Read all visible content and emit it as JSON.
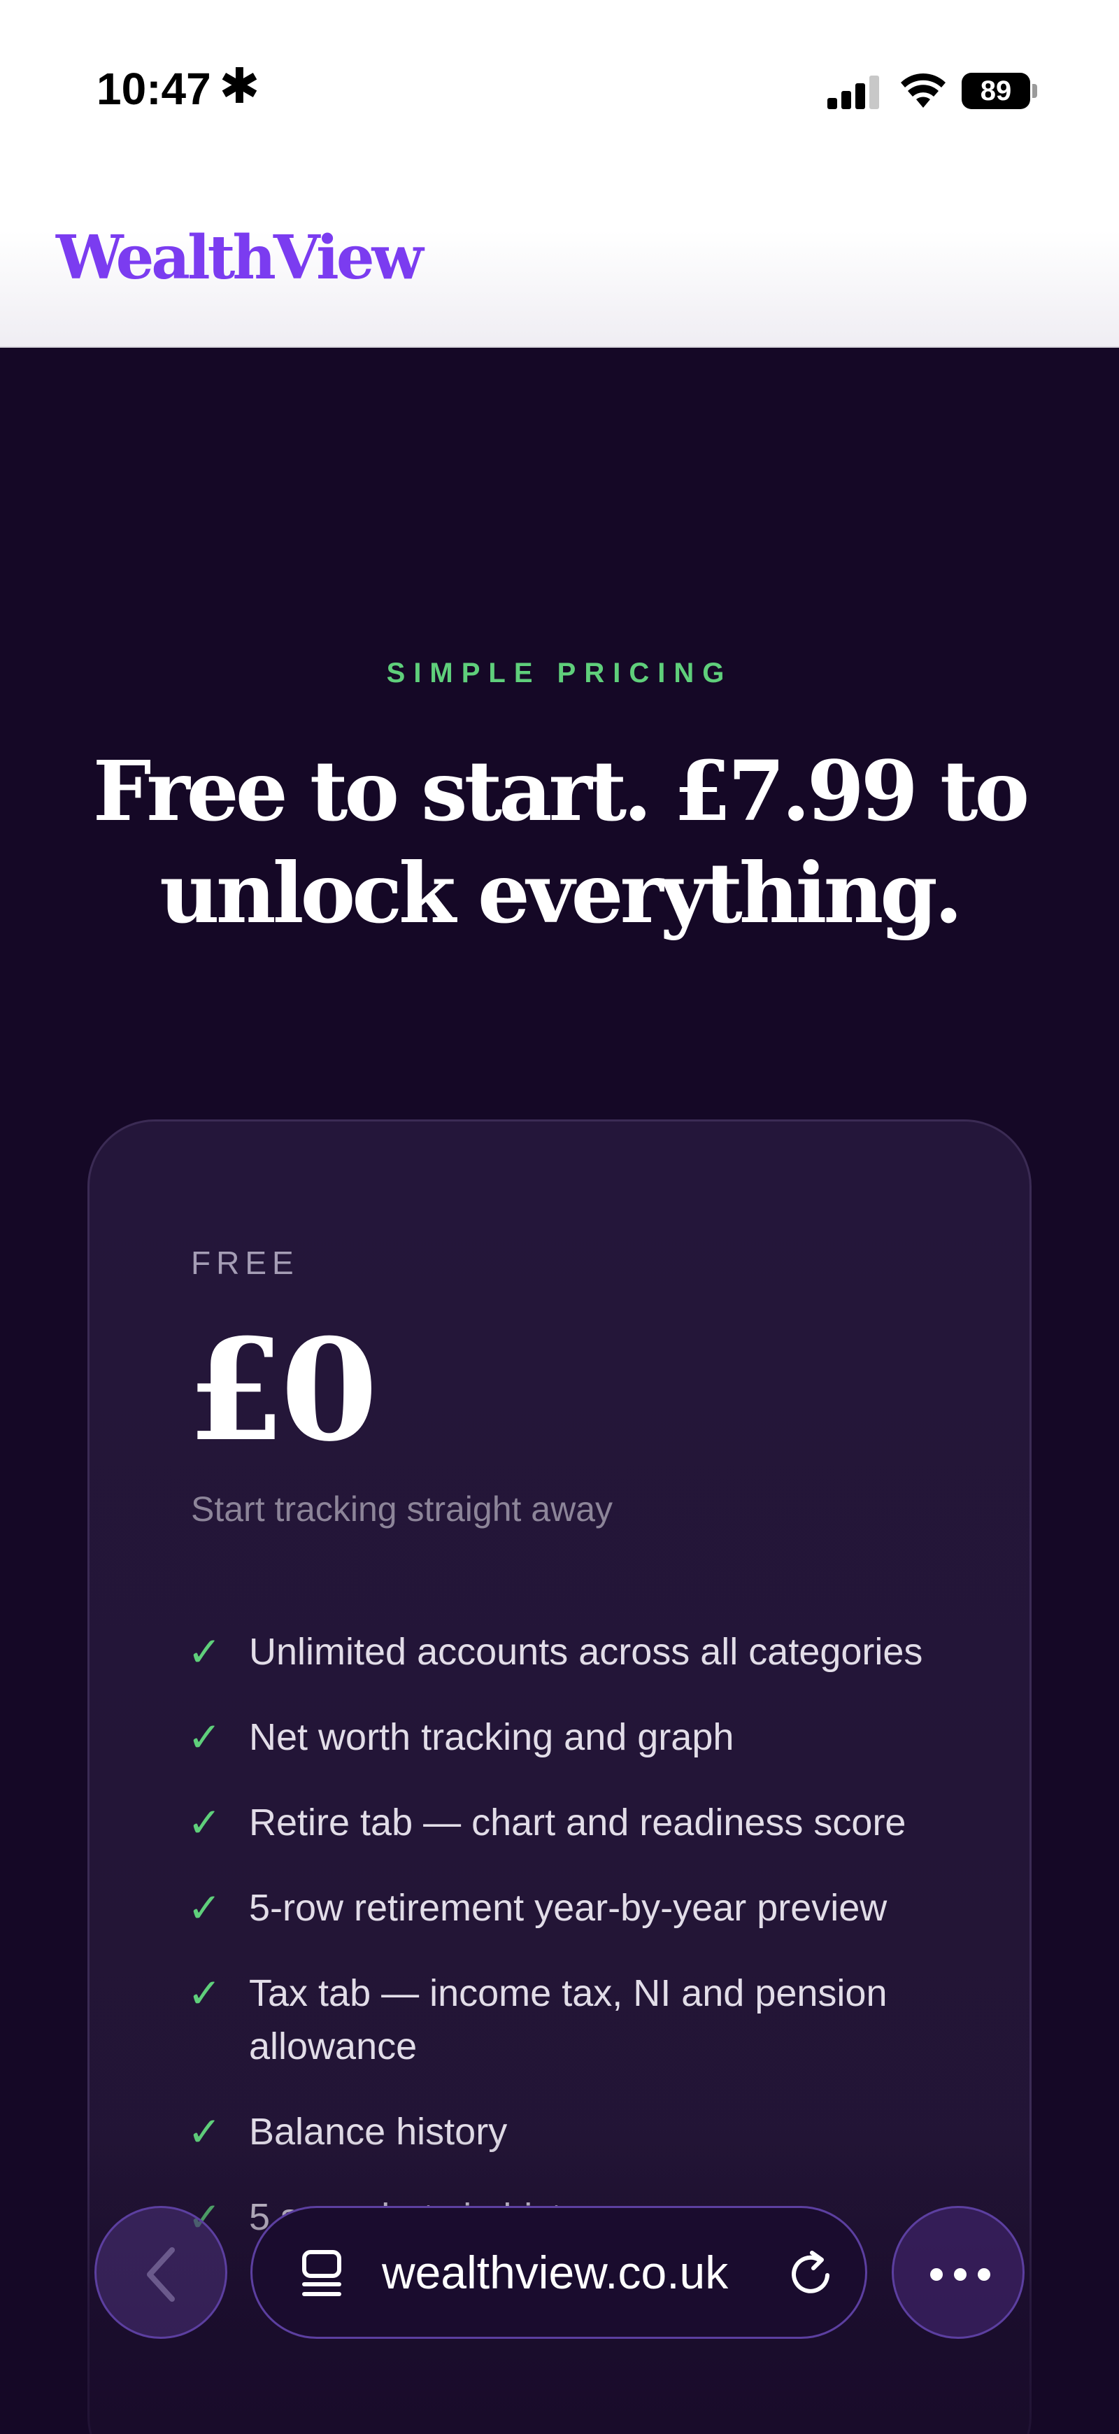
{
  "status_bar": {
    "time": "10:47",
    "asterisk": "✱",
    "battery": "89"
  },
  "header": {
    "logo": "WealthView"
  },
  "hero": {
    "eyebrow": "SIMPLE PRICING",
    "headline_line1": "Free to start. £7.99 to",
    "headline_line2": "unlock everything."
  },
  "plan": {
    "name": "FREE",
    "price": "£0",
    "subtitle": "Start tracking straight away",
    "check_glyph": "✓",
    "features": [
      "Unlimited accounts across all categories",
      "Net worth tracking and graph",
      "Retire tab — chart and readiness score",
      "5-row retirement year-by-year preview",
      "Tax tab — income tax, NI and pension allowance",
      "Balance history",
      "5 snapshots in history"
    ]
  },
  "browser": {
    "url": "wealthview.co.uk",
    "icons": [
      "back-icon",
      "tabs-icon",
      "reload-icon",
      "more-icon"
    ]
  },
  "colors": {
    "brand": "#7b3cf0",
    "accent_green": "#5fcf7b",
    "background": "#150826",
    "card": "#24163a"
  }
}
